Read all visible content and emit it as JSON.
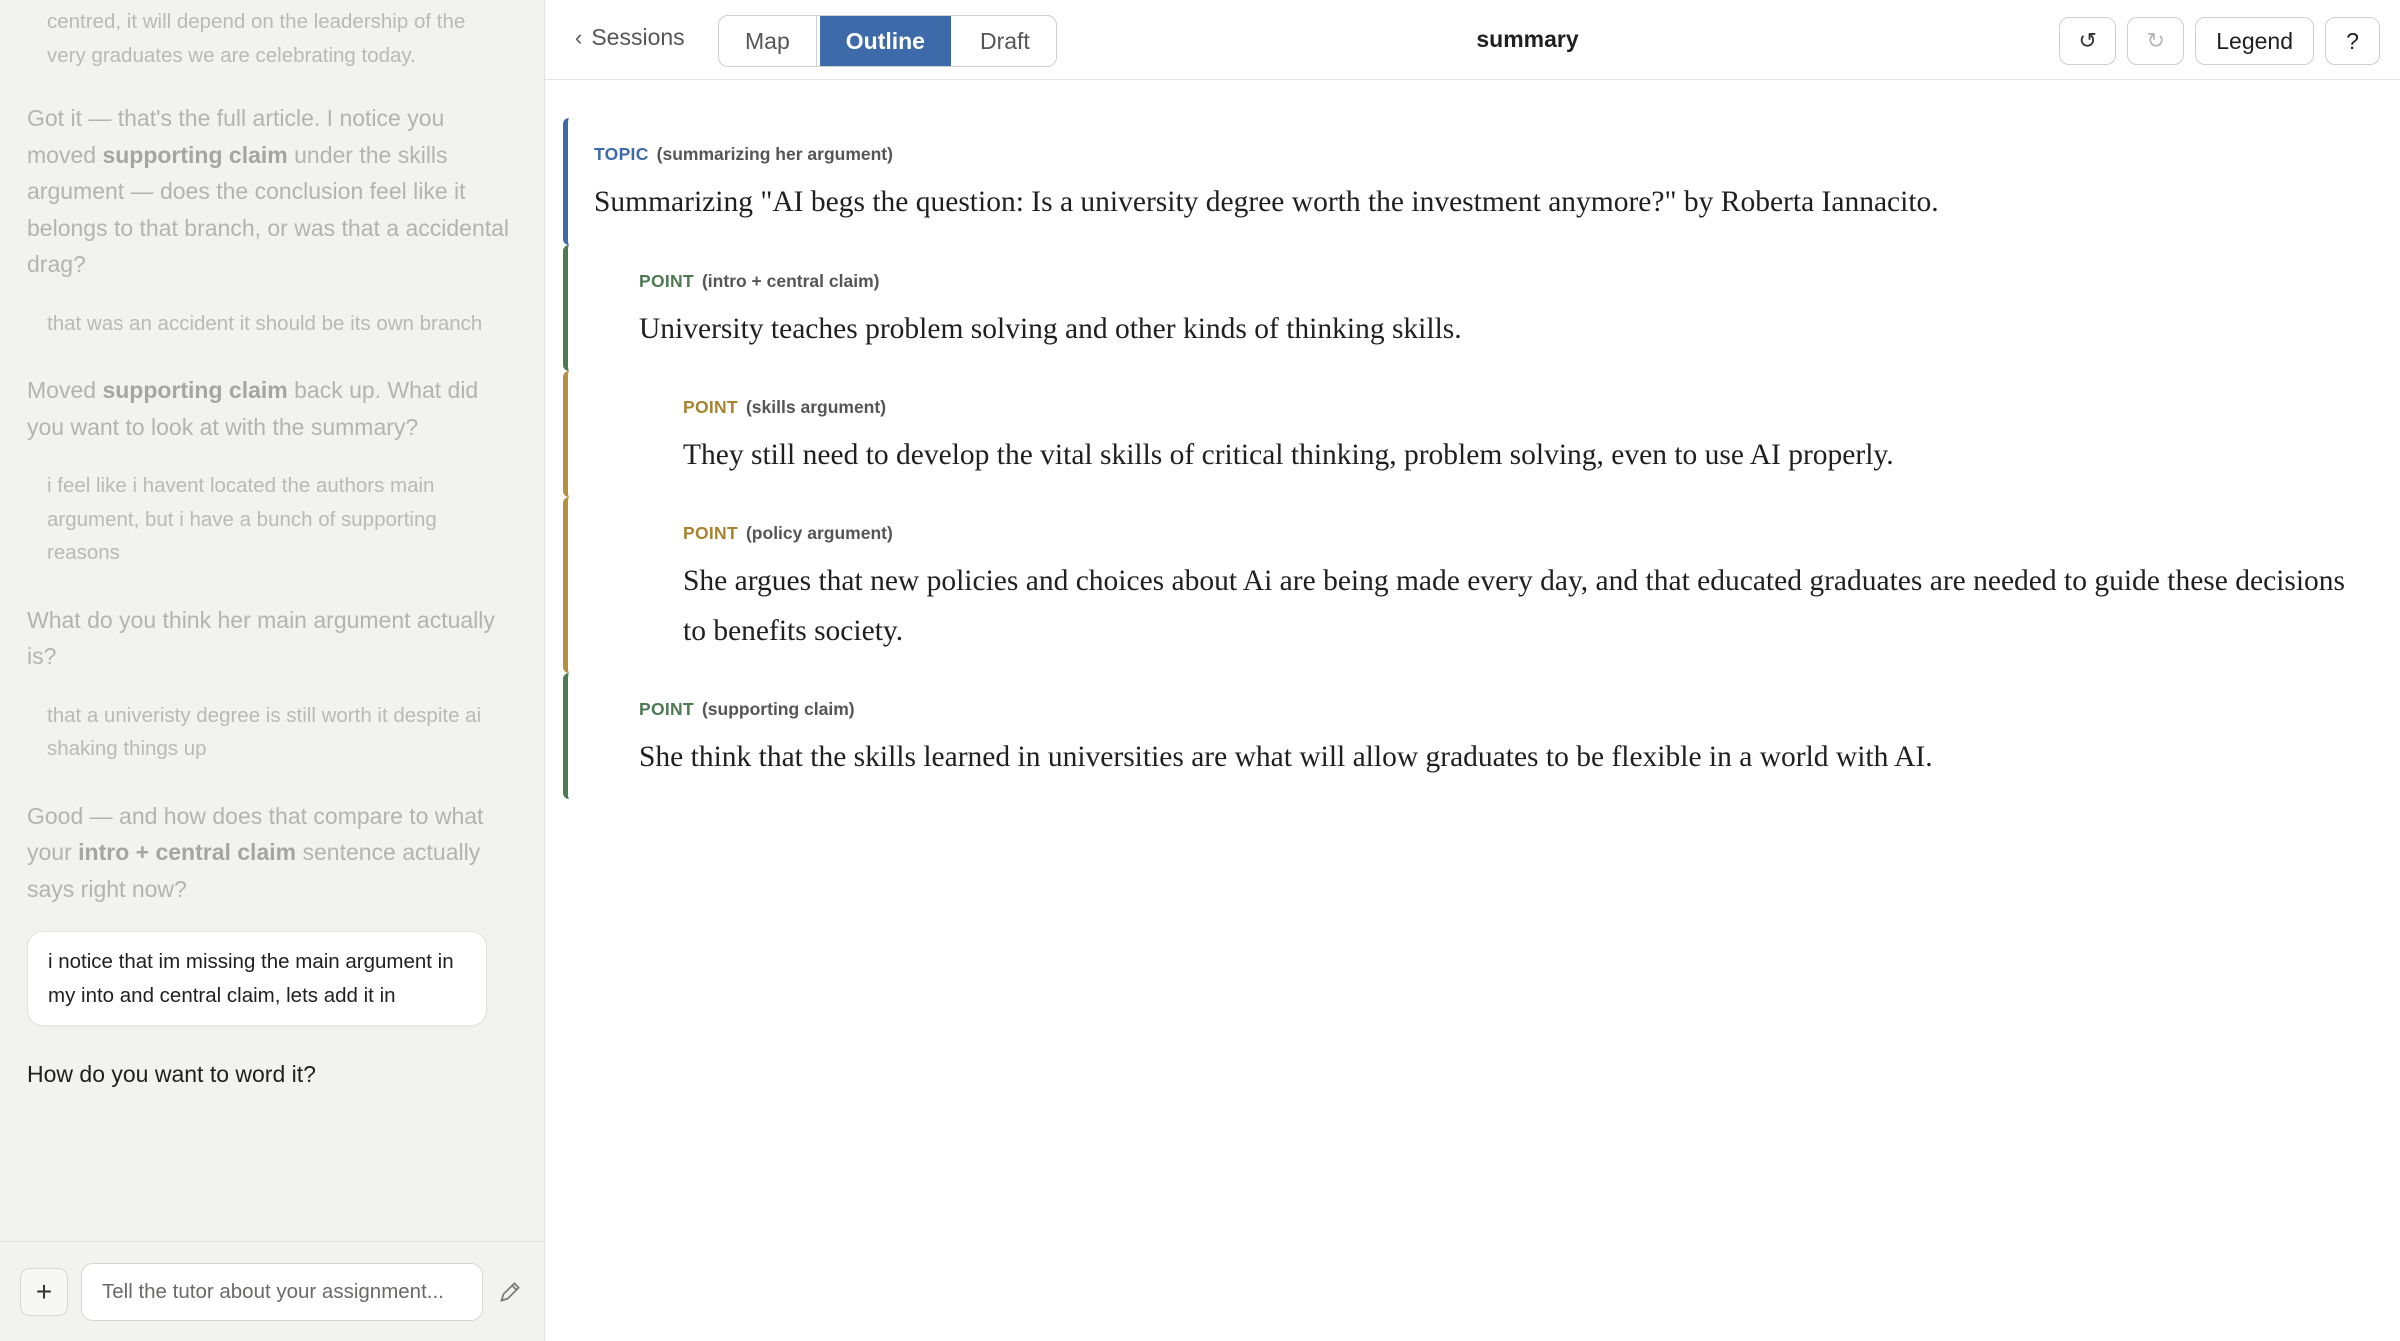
{
  "chat": {
    "messages": [
      {
        "role": "tutor",
        "html": [
          "centred, it will depend on the leadership of the very graduates we are celebrating today."
        ],
        "style": "user-like"
      },
      {
        "role": "tutor",
        "parts": [
          {
            "t": "Got it — that's the full article. I notice you moved "
          },
          {
            "b": "supporting claim"
          },
          {
            "t": " under the skills argument — does the conclusion feel like it belongs to that branch, or was that a accidental drag?"
          }
        ]
      },
      {
        "role": "user",
        "text": "that was an accident it should be its own branch"
      },
      {
        "role": "tutor",
        "parts": [
          {
            "t": "Moved "
          },
          {
            "b": "supporting claim"
          },
          {
            "t": " back up. What did you want to look at with the summary?"
          }
        ]
      },
      {
        "role": "user",
        "text": "i feel like i havent located the authors main argument, but i have a bunch of supporting reasons"
      },
      {
        "role": "tutor",
        "parts": [
          {
            "t": "What do you think her main argument actually is?"
          }
        ]
      },
      {
        "role": "user",
        "text": "that a univeristy degree is still worth it despite ai shaking things up"
      },
      {
        "role": "tutor",
        "parts": [
          {
            "t": "Good — and how does that compare to what your "
          },
          {
            "b": "intro + central claim"
          },
          {
            "t": " sentence actually says right now?"
          }
        ]
      }
    ],
    "top_fragment": "centred, it will depend on the leadership of the very graduates we are celebrating today.",
    "latest_user_bubble": "i notice that im missing the main argument in my into and central claim, lets add it in",
    "latest_tutor": "How do you want to word it?",
    "composer": {
      "add_label": "+",
      "placeholder": "Tell the tutor about your assignment..."
    }
  },
  "topbar": {
    "back_label": "Sessions",
    "back_icon": "chevron-left-icon",
    "tabs": [
      {
        "label": "Map",
        "active": false
      },
      {
        "label": "Outline",
        "active": true
      },
      {
        "label": "Draft",
        "active": false
      }
    ],
    "title": "summary",
    "undo_icon": "↺",
    "redo_icon": "↻",
    "legend_label": "Legend",
    "help_label": "?"
  },
  "outline": [
    {
      "kind": "TOPIC",
      "sub": "(summarizing her argument)",
      "color": "#3d6aa8",
      "text": "Summarizing \"AI begs the question: Is a university degree worth the investment anymore?\" by Roberta Iannacito."
    },
    {
      "kind": "POINT",
      "sub": "(intro + central claim)",
      "color": "#4d7a52",
      "text": "University teaches problem solving and other kinds of thinking skills."
    },
    {
      "kind": "POINT",
      "sub": "(skills argument)",
      "color": "#b8913f",
      "text": "They still need to develop the vital skills of critical thinking, problem solving, even to use AI properly."
    },
    {
      "kind": "POINT",
      "sub": "(policy argument)",
      "color": "#b8913f",
      "text": "She argues that new policies and choices about Ai are being made every day, and that educated graduates are needed to guide these decisions to benefits society."
    },
    {
      "kind": "POINT",
      "sub": "(supporting claim)",
      "color": "#4d7a52",
      "text": "She think that the skills learned in universities are what will allow graduates to be flexible in a world with AI."
    }
  ]
}
